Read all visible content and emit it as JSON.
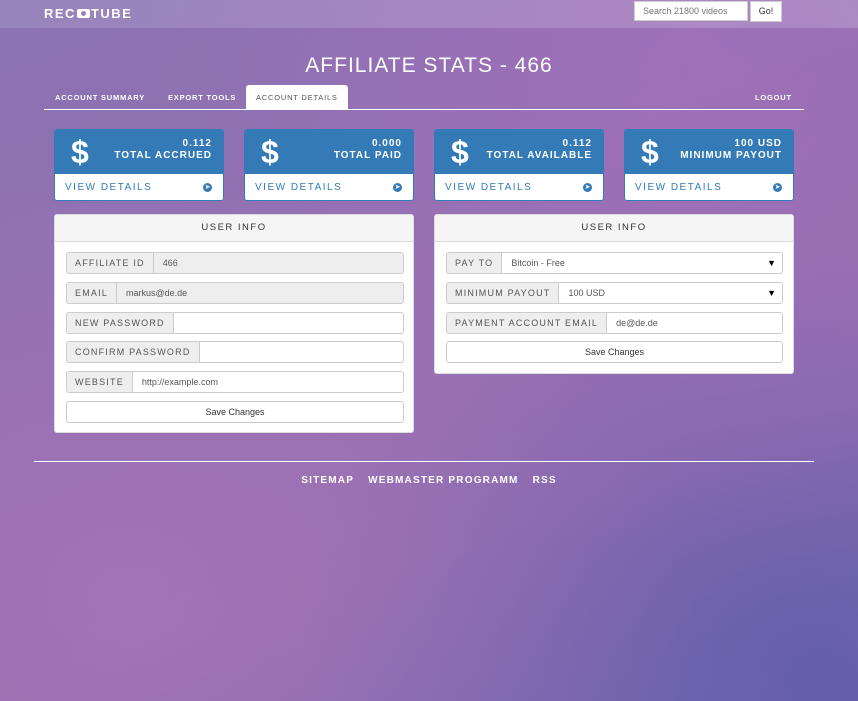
{
  "header": {
    "logo_left": "REC",
    "logo_right": "TUBE",
    "search_placeholder": "Search 21800 videos",
    "search_button": "Go!"
  },
  "page_title": "AFFILIATE STATS - 466",
  "tabs": [
    {
      "label": "ACCOUNT SUMMARY"
    },
    {
      "label": "EXPORT TOOLS"
    },
    {
      "label": "ACCOUNT DETAILS"
    }
  ],
  "logout": "LOGOUT",
  "stats": [
    {
      "symbol": "$",
      "value": "0.112",
      "label": "TOTAL ACCRUED",
      "link": "VIEW DETAILS"
    },
    {
      "symbol": "$",
      "value": "0.000",
      "label": "TOTAL PAID",
      "link": "VIEW DETAILS"
    },
    {
      "symbol": "$",
      "value": "0.112",
      "label": "TOTAL AVAILABLE",
      "link": "VIEW DETAILS"
    },
    {
      "symbol": "$",
      "value": "100 USD",
      "label": "MINIMUM PAYOUT",
      "link": "VIEW DETAILS"
    }
  ],
  "user_info_left": {
    "title": "USER INFO",
    "affiliate_id_label": "AFFILIATE ID",
    "affiliate_id_value": "466",
    "email_label": "EMAIL",
    "email_value": "markus@de.de",
    "new_password_label": "NEW PASSWORD",
    "confirm_password_label": "CONFIRM PASSWORD",
    "website_label": "WEBSITE",
    "website_value": "http://example.com",
    "save_button": "Save Changes"
  },
  "user_info_right": {
    "title": "USER INFO",
    "pay_to_label": "PAY TO",
    "pay_to_value": "Bitcoin - Free",
    "min_payout_label": "MINIMUM PAYOUT",
    "min_payout_value": "100 USD",
    "payment_email_label": "PAYMENT ACCOUNT EMAIL",
    "payment_email_value": "de@de.de",
    "save_button": "Save Changes"
  },
  "footer": [
    {
      "label": "SITEMAP"
    },
    {
      "label": "WEBMASTER PROGRAMM"
    },
    {
      "label": "RSS"
    }
  ],
  "colors": {
    "primary": "#337ab7",
    "panel_header": "#f5f5f5"
  },
  "icons": {
    "logo_camera": "camera-icon",
    "stat_arrow": "circle-arrow-right-icon",
    "select_caret": "caret-down-icon"
  }
}
